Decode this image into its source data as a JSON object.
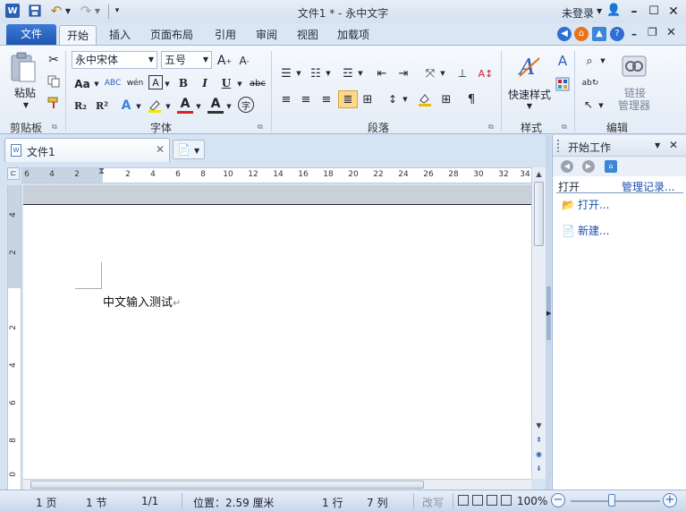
{
  "window": {
    "title": "文件1 * - 永中文字",
    "login": "未登录"
  },
  "tabs": {
    "file": "文件",
    "home": "开始",
    "insert": "插入",
    "layout": "页面布局",
    "references": "引用",
    "review": "审阅",
    "view": "视图",
    "addins": "加载项"
  },
  "ribbon": {
    "clipboard": {
      "paste": "粘贴",
      "label": "剪贴板"
    },
    "font": {
      "label": "字体",
      "font_name": "永中宋体",
      "font_size": "五号",
      "grow": "A",
      "shrink": "A",
      "case": "Aa",
      "bold": "B",
      "italic": "I",
      "underline": "U",
      "strike": "abc",
      "subscript": "R₂",
      "superscript": "R²",
      "phonetic": "wén",
      "border_char": "A",
      "font_color": "A",
      "shade": "A",
      "encircle": "字"
    },
    "paragraph": {
      "label": "段落"
    },
    "styles": {
      "quick": "快速样式",
      "label": "样式"
    },
    "editing": {
      "link": "链接\n管理器",
      "link_line1": "链接",
      "link_line2": "管理器",
      "label": "编辑"
    }
  },
  "document": {
    "tab_label": "文件1",
    "body_text": "中文输入测试",
    "para_mark": "↵",
    "ruler_h": [
      "6",
      "4",
      "2",
      "2",
      "4",
      "6",
      "8",
      "10",
      "12",
      "14",
      "16",
      "18",
      "20",
      "22",
      "24",
      "26",
      "28",
      "30",
      "32",
      "34"
    ],
    "ruler_v": [
      "4",
      "2",
      "2",
      "4",
      "6",
      "8",
      "0"
    ]
  },
  "taskpane": {
    "title": "开始工作",
    "section": "打开",
    "manage": "管理记录...",
    "open": "打开...",
    "new": "新建..."
  },
  "status": {
    "page": "1 页",
    "section": "1 节",
    "pages": "1/1",
    "position": "位置：2.59 厘米",
    "line": "1 行",
    "column": "7 列",
    "overtype": "改写",
    "zoom": "100%"
  },
  "colors": {
    "accent": "#2b5fb8",
    "file_tab": "#1f57b0",
    "link": "#1a4fb0"
  }
}
